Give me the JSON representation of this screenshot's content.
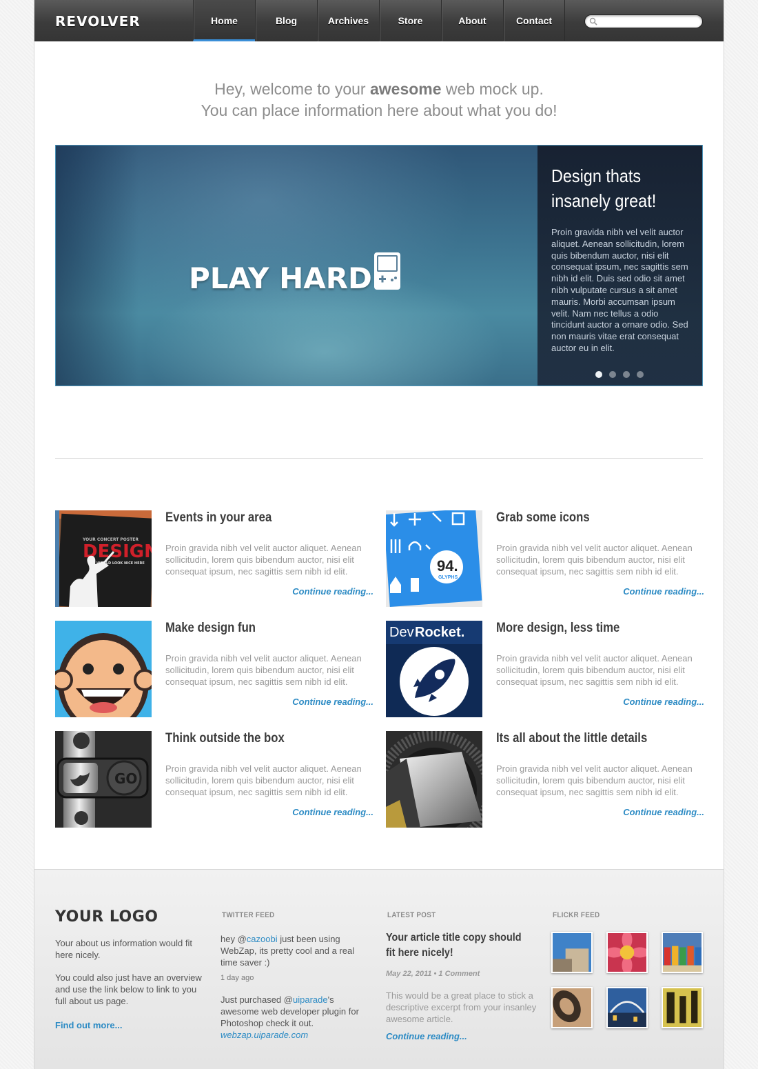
{
  "nav": {
    "logo": "REVOLVER",
    "items": [
      {
        "label": "Home"
      },
      {
        "label": "Blog"
      },
      {
        "label": "Archives"
      },
      {
        "label": "Store"
      },
      {
        "label": "About"
      },
      {
        "label": "Contact"
      }
    ],
    "active": "Home",
    "search_placeholder": ""
  },
  "intro": {
    "line1_a": "Hey, welcome to your ",
    "line1_b": "awesome",
    "line1_c": " web mock up.",
    "line2": "You can place information here about what you do!"
  },
  "hero": {
    "headline": "PLAY HARD",
    "panel_title_1": "Design thats",
    "panel_title_2": "insanely great!",
    "panel_text": "Proin gravida nibh vel velit auctor aliquet. Aenean sollicitudin, lorem quis bibendum auctor, nisi elit consequat ipsum, nec sagittis sem nibh id elit. Duis sed odio sit amet nibh vulputate cursus a sit amet mauris. Morbi accumsan ipsum velit. Nam nec tellus a odio tincidunt auctor a ornare odio. Sed non  mauris vitae erat consequat auctor eu in elit.",
    "slide_count": 4,
    "active_slide": 1
  },
  "posts": [
    {
      "title": "Events in your area",
      "text": "Proin gravida nibh vel velit auctor aliquet. Aenean sollicitudin, lorem quis bibendum auctor, nisi elit consequat ipsum, nec sagittis sem nibh id elit.",
      "more": "Continue reading..."
    },
    {
      "title": "Grab some icons",
      "text": "Proin gravida nibh vel velit auctor aliquet. Aenean sollicitudin, lorem quis bibendum auctor, nisi elit consequat ipsum, nec sagittis sem nibh id elit.",
      "more": "Continue reading..."
    },
    {
      "title": "Make design fun",
      "text": "Proin gravida nibh vel velit auctor aliquet. Aenean sollicitudin, lorem quis bibendum auctor, nisi elit consequat ipsum, nec sagittis sem nibh id elit.",
      "more": "Continue reading..."
    },
    {
      "title": "More design, less time",
      "text": "Proin gravida nibh vel velit auctor aliquet. Aenean sollicitudin, lorem quis bibendum auctor, nisi elit consequat ipsum, nec sagittis sem nibh id elit.",
      "more": "Continue reading..."
    },
    {
      "title": "Think outside the box",
      "text": "Proin gravida nibh vel velit auctor aliquet. Aenean sollicitudin, lorem quis bibendum auctor, nisi elit consequat ipsum, nec sagittis sem nibh id elit.",
      "more": "Continue reading..."
    },
    {
      "title": "Its all about the little details",
      "text": "Proin gravida nibh vel velit auctor aliquet. Aenean sollicitudin, lorem quis bibendum auctor, nisi elit consequat ipsum, nec sagittis sem nibh id elit.",
      "more": "Continue reading..."
    }
  ],
  "thumb_text": {
    "poster_top": "YOUR CONCERT POSTER",
    "poster_big": "DESIGN",
    "poster_sub": "WOULD LOOK NICE HERE",
    "glyph_num": "94.",
    "glyph_label": "GLYPHS",
    "devrocket_a": "Dev",
    "devrocket_b": "Rocket.",
    "go": "GO"
  },
  "footer": {
    "logo": "YOUR LOGO",
    "about_1": "Your about us information would fit here nicely.",
    "about_2": "You could also just have an overview and use the link below to link to you full about us page.",
    "about_link": "Find out more...",
    "twitter_head": "TWITTER FEED",
    "tweet1_a": "hey @",
    "tweet1_handle": "cazoobi",
    "tweet1_b": " just been using WebZap, its pretty cool and a real time saver :)",
    "tweet1_time": "1 day ago",
    "tweet2_a": "Just purchased @",
    "tweet2_handle": "uiparade",
    "tweet2_b": "'s awesome web developer plugin for Photoshop check it out.",
    "tweet2_link": "webzap.uiparade.com",
    "latest_head": "LATEST POST",
    "latest_title": "Your article title copy should fit here nicely!",
    "latest_meta": "May 22, 2011 • 1 Comment",
    "latest_text": "This would be a great place to stick a descriptive excerpt from your insanley awesome article.",
    "latest_more": "Continue reading...",
    "flickr_head": "FLICKR FEED"
  },
  "colors": {
    "accent": "#2d8bc4",
    "nav_active": "#3a8fd8",
    "nav_bg": "#3c3c3c"
  }
}
